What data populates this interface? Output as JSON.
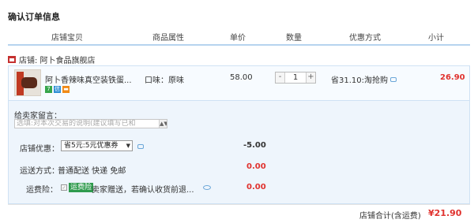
{
  "page": {
    "title": "确认订单信息"
  },
  "columns": [
    "店铺宝贝",
    "商品属性",
    "单价",
    "数量",
    "优惠方式",
    "小计"
  ],
  "shop": {
    "label": "店铺: 阿卜食品旗舰店"
  },
  "item": {
    "title": "阿卜香辣味真空装铁蛋...",
    "attribute": "口味：原味",
    "price": "58.00",
    "quantity": "1",
    "minus": "-",
    "plus": "+",
    "promotion": "省31.10:淘抢购",
    "subtotal": "26.90",
    "badges": [
      "7",
      "信",
      "▬"
    ]
  },
  "message": {
    "label": "给卖家留言：",
    "placeholder": "选填:对本次交易的说明(建议填写已和",
    "scroll_glyph": "▲▼"
  },
  "coupon": {
    "label": "店铺优惠：",
    "selected": "省5元:5元优惠券",
    "arrow": "▼",
    "amount": "-5.00"
  },
  "shipping": {
    "label": "运送方式：",
    "value": "普通配送 快递 免邮",
    "amount": "0.00"
  },
  "insurance": {
    "label": "运费险：",
    "checkbox": "✓",
    "tag": "运费险",
    "description": "卖家赠送，若确认收货前退...",
    "amount": "0.00"
  },
  "total": {
    "label": "店铺合计(含运费)",
    "value": "¥21.90"
  },
  "colors": {
    "price_red": "#e0322e",
    "header_border": "#b6d3ef",
    "panel_bg": "#eef5fc",
    "insurance_green": "#2f9b4e"
  }
}
